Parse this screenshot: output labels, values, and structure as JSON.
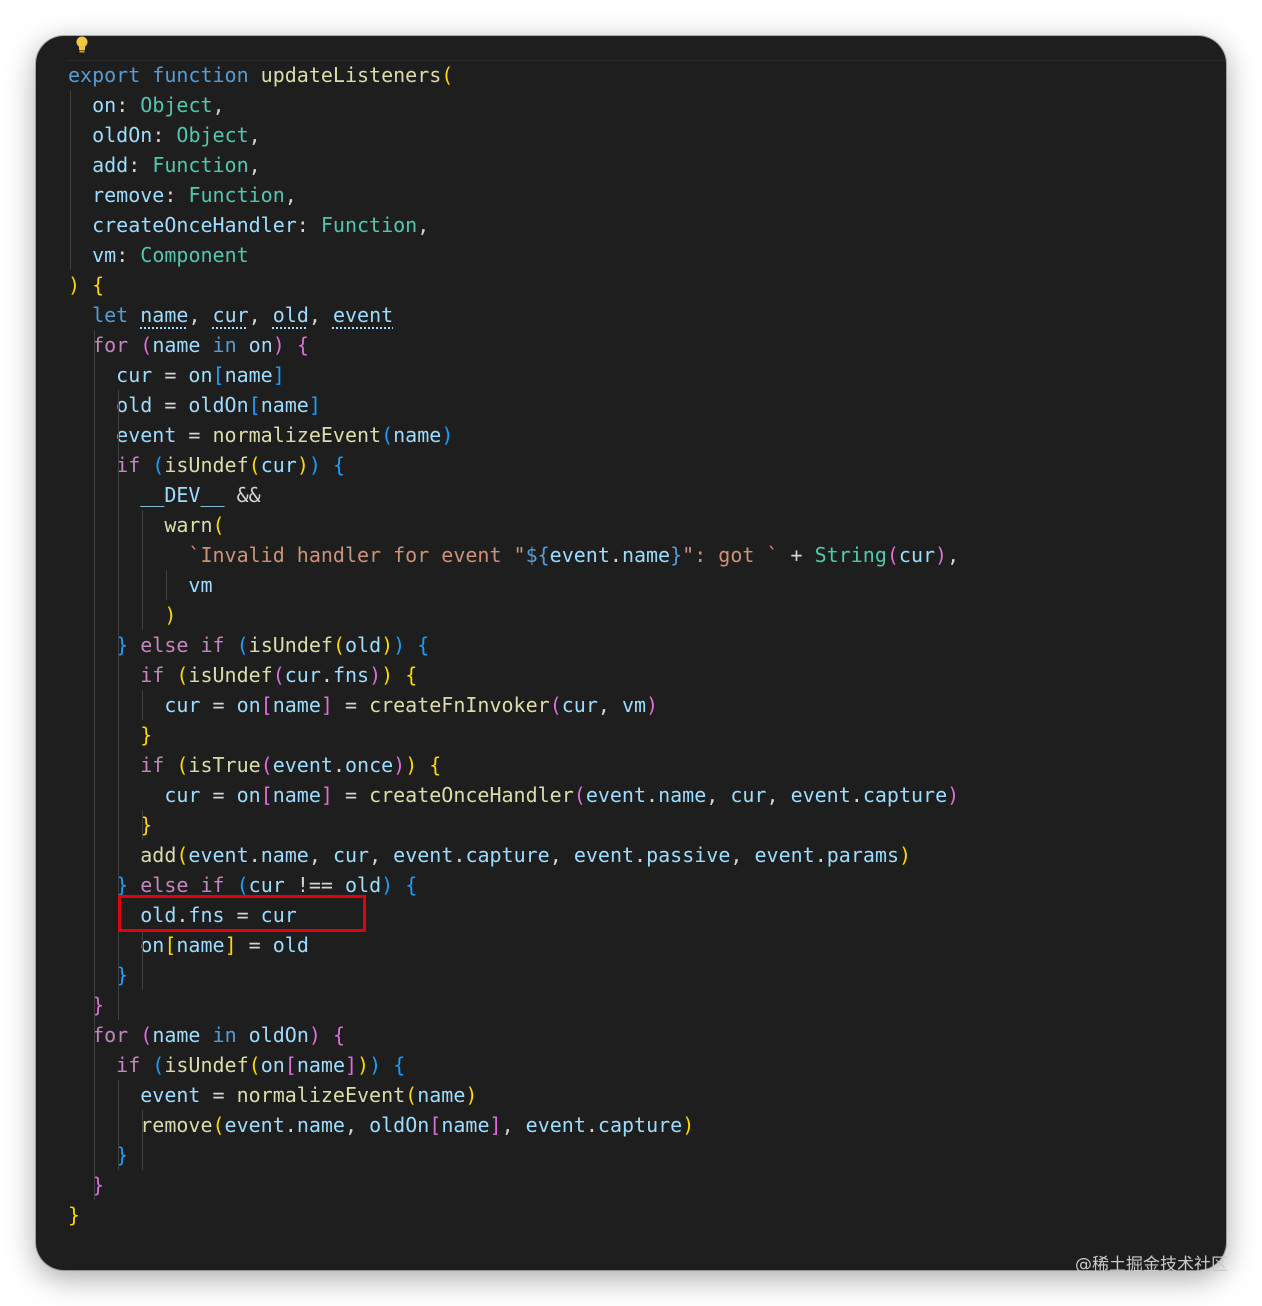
{
  "editor": {
    "theme": "dark",
    "background": "#1e1e1e",
    "lightbulb_icon": "lightbulb-icon",
    "highlight_color": "#e3000f"
  },
  "code_lines": [
    [
      [
        "export ",
        "kw"
      ],
      [
        "function ",
        "kw"
      ],
      [
        "updateListeners",
        "fn"
      ],
      [
        "(",
        "b1"
      ]
    ],
    [
      [
        "  "
      ],
      [
        "on",
        "var"
      ],
      [
        ": "
      ],
      [
        "Object",
        "ty"
      ],
      [
        ","
      ]
    ],
    [
      [
        "  "
      ],
      [
        "oldOn",
        "var"
      ],
      [
        ": "
      ],
      [
        "Object",
        "ty"
      ],
      [
        ","
      ]
    ],
    [
      [
        "  "
      ],
      [
        "add",
        "var"
      ],
      [
        ": "
      ],
      [
        "Function",
        "ty"
      ],
      [
        ","
      ]
    ],
    [
      [
        "  "
      ],
      [
        "remove",
        "var"
      ],
      [
        ": "
      ],
      [
        "Function",
        "ty"
      ],
      [
        ","
      ]
    ],
    [
      [
        "  "
      ],
      [
        "createOnceHandler",
        "var"
      ],
      [
        ": "
      ],
      [
        "Function",
        "ty"
      ],
      [
        ","
      ]
    ],
    [
      [
        "  "
      ],
      [
        "vm",
        "var"
      ],
      [
        ": "
      ],
      [
        "Component",
        "ty"
      ]
    ],
    [
      [
        ")",
        "b1"
      ],
      [
        " "
      ],
      [
        "{",
        "b1"
      ]
    ],
    [
      [
        "  "
      ],
      [
        "let ",
        "kw"
      ],
      [
        "name",
        "var dotted"
      ],
      [
        ", "
      ],
      [
        "cur",
        "var dotted"
      ],
      [
        ", "
      ],
      [
        "old",
        "var dotted"
      ],
      [
        ", "
      ],
      [
        "event",
        "var dotted"
      ]
    ],
    [
      [
        "  "
      ],
      [
        "for ",
        "ctl"
      ],
      [
        "(",
        "b2"
      ],
      [
        "name ",
        "var"
      ],
      [
        "in ",
        "kw"
      ],
      [
        "on",
        "var"
      ],
      [
        ")",
        "b2"
      ],
      [
        " "
      ],
      [
        "{",
        "b2"
      ]
    ],
    [
      [
        "    "
      ],
      [
        "cur",
        "var"
      ],
      [
        " = "
      ],
      [
        "on",
        "var"
      ],
      [
        "[",
        "b3"
      ],
      [
        "name",
        "var"
      ],
      [
        "]",
        "b3"
      ]
    ],
    [
      [
        "    "
      ],
      [
        "old",
        "var"
      ],
      [
        " = "
      ],
      [
        "oldOn",
        "var"
      ],
      [
        "[",
        "b3"
      ],
      [
        "name",
        "var"
      ],
      [
        "]",
        "b3"
      ]
    ],
    [
      [
        "    "
      ],
      [
        "event",
        "var"
      ],
      [
        " = "
      ],
      [
        "normalizeEvent",
        "fn"
      ],
      [
        "(",
        "b3"
      ],
      [
        "name",
        "var"
      ],
      [
        ")",
        "b3"
      ]
    ],
    [
      [
        "    "
      ],
      [
        "if ",
        "ctl"
      ],
      [
        "(",
        "b3"
      ],
      [
        "isUndef",
        "fn"
      ],
      [
        "(",
        "b1"
      ],
      [
        "cur",
        "var"
      ],
      [
        ")",
        "b1"
      ],
      [
        ")",
        "b3"
      ],
      [
        " "
      ],
      [
        "{",
        "b3"
      ]
    ],
    [
      [
        "      "
      ],
      [
        "__DEV__",
        "var"
      ],
      [
        " &&"
      ]
    ],
    [
      [
        "        "
      ],
      [
        "warn",
        "fn"
      ],
      [
        "(",
        "b1"
      ]
    ],
    [
      [
        "          "
      ],
      [
        "`Invalid handler for event \"",
        "str"
      ],
      [
        "${",
        "kw"
      ],
      [
        "event",
        "var"
      ],
      [
        "."
      ],
      [
        "name",
        "var"
      ],
      [
        "}",
        "kw"
      ],
      [
        "\": got ` ",
        "str"
      ],
      [
        "+ "
      ],
      [
        "String",
        "ty"
      ],
      [
        "(",
        "b2"
      ],
      [
        "cur",
        "var"
      ],
      [
        ")",
        "b2"
      ],
      [
        ","
      ]
    ],
    [
      [
        "          "
      ],
      [
        "vm",
        "var"
      ]
    ],
    [
      [
        "        "
      ],
      [
        ")",
        "b1"
      ]
    ],
    [
      [
        "    "
      ],
      [
        "}",
        "b3"
      ],
      [
        " "
      ],
      [
        "else ",
        "ctl"
      ],
      [
        "if ",
        "ctl"
      ],
      [
        "(",
        "b3"
      ],
      [
        "isUndef",
        "fn"
      ],
      [
        "(",
        "b1"
      ],
      [
        "old",
        "var"
      ],
      [
        ")",
        "b1"
      ],
      [
        ")",
        "b3"
      ],
      [
        " "
      ],
      [
        "{",
        "b3"
      ]
    ],
    [
      [
        "      "
      ],
      [
        "if ",
        "ctl"
      ],
      [
        "(",
        "b1"
      ],
      [
        "isUndef",
        "fn"
      ],
      [
        "(",
        "b2"
      ],
      [
        "cur",
        "var"
      ],
      [
        "."
      ],
      [
        "fns",
        "var"
      ],
      [
        ")",
        "b2"
      ],
      [
        ")",
        "b1"
      ],
      [
        " "
      ],
      [
        "{",
        "b1"
      ]
    ],
    [
      [
        "        "
      ],
      [
        "cur",
        "var"
      ],
      [
        " = "
      ],
      [
        "on",
        "var"
      ],
      [
        "[",
        "b2"
      ],
      [
        "name",
        "var"
      ],
      [
        "]",
        "b2"
      ],
      [
        " = "
      ],
      [
        "createFnInvoker",
        "fn"
      ],
      [
        "(",
        "b2"
      ],
      [
        "cur",
        "var"
      ],
      [
        ", "
      ],
      [
        "vm",
        "var"
      ],
      [
        ")",
        "b2"
      ]
    ],
    [
      [
        "      "
      ],
      [
        "}",
        "b1"
      ]
    ],
    [
      [
        "      "
      ],
      [
        "if ",
        "ctl"
      ],
      [
        "(",
        "b1"
      ],
      [
        "isTrue",
        "fn"
      ],
      [
        "(",
        "b2"
      ],
      [
        "event",
        "var"
      ],
      [
        "."
      ],
      [
        "once",
        "var"
      ],
      [
        ")",
        "b2"
      ],
      [
        ")",
        "b1"
      ],
      [
        " "
      ],
      [
        "{",
        "b1"
      ]
    ],
    [
      [
        "        "
      ],
      [
        "cur",
        "var"
      ],
      [
        " = "
      ],
      [
        "on",
        "var"
      ],
      [
        "[",
        "b2"
      ],
      [
        "name",
        "var"
      ],
      [
        "]",
        "b2"
      ],
      [
        " = "
      ],
      [
        "createOnceHandler",
        "fn"
      ],
      [
        "(",
        "b2"
      ],
      [
        "event",
        "var"
      ],
      [
        "."
      ],
      [
        "name",
        "var"
      ],
      [
        ", "
      ],
      [
        "cur",
        "var"
      ],
      [
        ", "
      ],
      [
        "event",
        "var"
      ],
      [
        "."
      ],
      [
        "capture",
        "var"
      ],
      [
        ")",
        "b2"
      ]
    ],
    [
      [
        "      "
      ],
      [
        "}",
        "b1"
      ]
    ],
    [
      [
        "      "
      ],
      [
        "add",
        "fn"
      ],
      [
        "(",
        "b1"
      ],
      [
        "event",
        "var"
      ],
      [
        "."
      ],
      [
        "name",
        "var"
      ],
      [
        ", "
      ],
      [
        "cur",
        "var"
      ],
      [
        ", "
      ],
      [
        "event",
        "var"
      ],
      [
        "."
      ],
      [
        "capture",
        "var"
      ],
      [
        ", "
      ],
      [
        "event",
        "var"
      ],
      [
        "."
      ],
      [
        "passive",
        "var"
      ],
      [
        ", "
      ],
      [
        "event",
        "var"
      ],
      [
        "."
      ],
      [
        "params",
        "var"
      ],
      [
        ")",
        "b1"
      ]
    ],
    [
      [
        "    "
      ],
      [
        "}",
        "b3"
      ],
      [
        " "
      ],
      [
        "else ",
        "ctl"
      ],
      [
        "if ",
        "ctl"
      ],
      [
        "(",
        "b3"
      ],
      [
        "cur ",
        "var"
      ],
      [
        "!== "
      ],
      [
        "old",
        "var"
      ],
      [
        ")",
        "b3"
      ],
      [
        " "
      ],
      [
        "{",
        "b3"
      ]
    ],
    [
      [
        "      "
      ],
      [
        "old",
        "var"
      ],
      [
        "."
      ],
      [
        "fns",
        "var"
      ],
      [
        " = "
      ],
      [
        "cur",
        "var"
      ]
    ],
    [
      [
        "      "
      ],
      [
        "on",
        "var"
      ],
      [
        "[",
        "b1"
      ],
      [
        "name",
        "var"
      ],
      [
        "]",
        "b1"
      ],
      [
        " = "
      ],
      [
        "old",
        "var"
      ]
    ],
    [
      [
        "    "
      ],
      [
        "}",
        "b3"
      ]
    ],
    [
      [
        "  "
      ],
      [
        "}",
        "b2"
      ]
    ],
    [
      [
        "  "
      ],
      [
        "for ",
        "ctl"
      ],
      [
        "(",
        "b2"
      ],
      [
        "name ",
        "var"
      ],
      [
        "in ",
        "kw"
      ],
      [
        "oldOn",
        "var"
      ],
      [
        ")",
        "b2"
      ],
      [
        " "
      ],
      [
        "{",
        "b2"
      ]
    ],
    [
      [
        "    "
      ],
      [
        "if ",
        "ctl"
      ],
      [
        "(",
        "b3"
      ],
      [
        "isUndef",
        "fn"
      ],
      [
        "(",
        "b1"
      ],
      [
        "on",
        "var"
      ],
      [
        "[",
        "b2"
      ],
      [
        "name",
        "var"
      ],
      [
        "]",
        "b2"
      ],
      [
        ")",
        "b1"
      ],
      [
        ")",
        "b3"
      ],
      [
        " "
      ],
      [
        "{",
        "b3"
      ]
    ],
    [
      [
        "      "
      ],
      [
        "event",
        "var"
      ],
      [
        " = "
      ],
      [
        "normalizeEvent",
        "fn"
      ],
      [
        "(",
        "b1"
      ],
      [
        "name",
        "var"
      ],
      [
        ")",
        "b1"
      ]
    ],
    [
      [
        "      "
      ],
      [
        "remove",
        "fn"
      ],
      [
        "(",
        "b1"
      ],
      [
        "event",
        "var"
      ],
      [
        "."
      ],
      [
        "name",
        "var"
      ],
      [
        ", "
      ],
      [
        "oldOn",
        "var"
      ],
      [
        "[",
        "b2"
      ],
      [
        "name",
        "var"
      ],
      [
        "]",
        "b2"
      ],
      [
        ", "
      ],
      [
        "event",
        "var"
      ],
      [
        "."
      ],
      [
        "capture",
        "var"
      ],
      [
        ")",
        "b1"
      ]
    ],
    [
      [
        "    "
      ],
      [
        "}",
        "b3"
      ]
    ],
    [
      [
        "  "
      ],
      [
        "}",
        "b2"
      ]
    ],
    [
      [
        "}",
        "b1"
      ]
    ]
  ],
  "watermark": "@稀土掘金技术社区"
}
